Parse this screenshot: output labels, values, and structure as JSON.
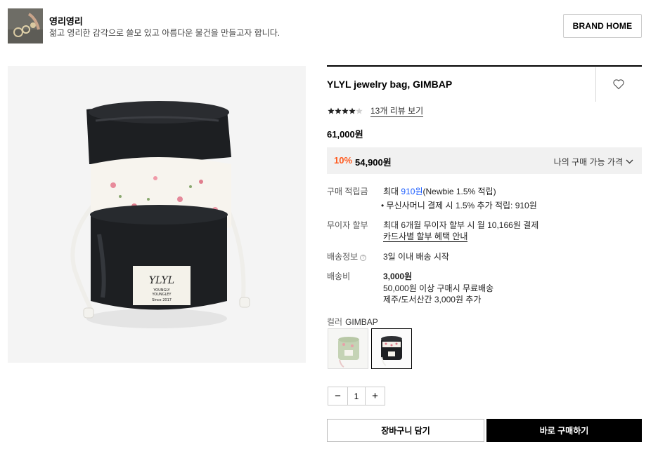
{
  "brand": {
    "name": "영리영리",
    "description": "젊고 영리한 감각으로 쓸모 있고 아름다운 물건을 만들고자 합니다.",
    "home_button": "BRAND HOME"
  },
  "product": {
    "title": "YLYL jewelry bag, GIMBAP",
    "rating": 4.5,
    "review_link": "13개 리뷰 보기",
    "original_price": "61,000원",
    "discount": "10%",
    "sale_price": "54,900원",
    "my_price_label": "나의 구매 가능 가격"
  },
  "image_label": {
    "logo": "YLYL",
    "line1": "YOUNGLY",
    "line2": "YOUNGLEY",
    "line3": "Since 2017"
  },
  "details": {
    "points_label": "구매 적립금",
    "points_prefix": "최대 ",
    "points_amount": "910원",
    "points_suffix": "(Newbie 1.5% 적립)",
    "points_bullet": "•  무신사머니 결제 시 1.5% 추가 적립: 910원",
    "installment_label": "무이자 할부",
    "installment_value": "최대 6개월 무이자 할부 시 월 10,166원 결제",
    "installment_link": "카드사별 할부 혜택 안내",
    "shipping_label": "배송정보",
    "shipping_value": "3일 이내 배송 시작",
    "fee_label": "배송비",
    "fee_value": "3,000원",
    "fee_line2": "50,000원 이상 구매시 무료배송",
    "fee_line3": "제주/도서산간 3,000원 추가"
  },
  "options": {
    "color_label": "컬러",
    "color_value": "GIMBAP"
  },
  "quantity": {
    "minus": "−",
    "value": "1",
    "plus": "+"
  },
  "actions": {
    "cart": "장바구니 담기",
    "buy": "바로 구매하기"
  },
  "colors": {
    "accent_discount": "#ff5a1f",
    "points_blue": "#1a5cff",
    "bag_black": "#1d1f22",
    "green_option": "#c5d3b5"
  }
}
